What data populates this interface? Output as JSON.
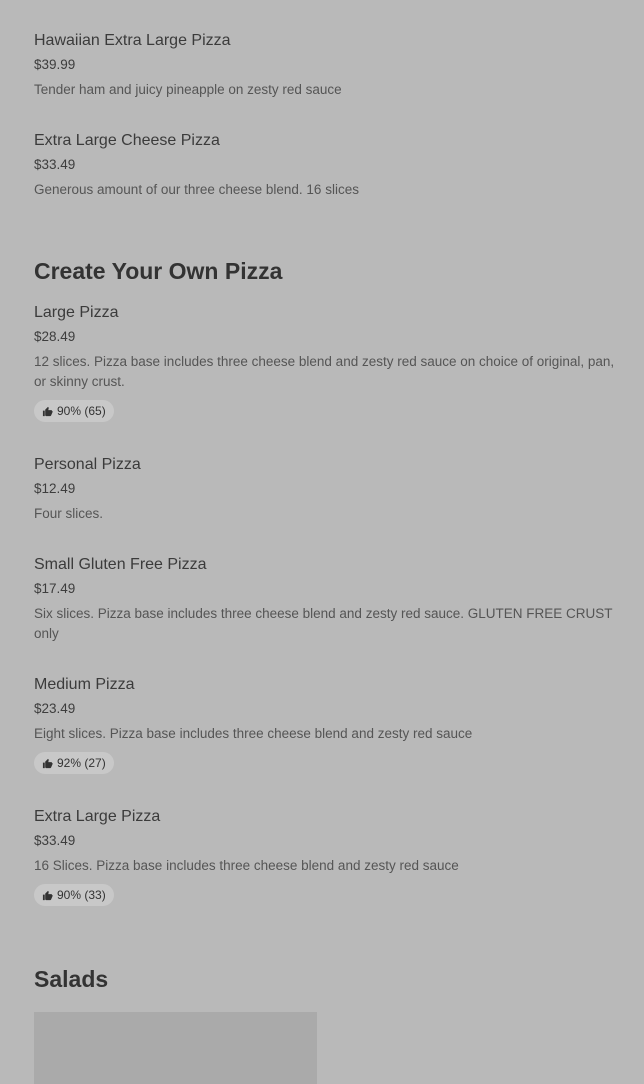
{
  "items_top": [
    {
      "name": "Hawaiian Extra Large Pizza",
      "price": "$39.99",
      "description": "Tender ham and juicy pineapple on zesty red sauce"
    },
    {
      "name": "Extra Large Cheese Pizza",
      "price": "$33.49",
      "description": "Generous amount of our three cheese blend. 16 slices"
    }
  ],
  "section_create": {
    "title": "Create Your Own Pizza",
    "items": [
      {
        "name": "Large Pizza",
        "price": "$28.49",
        "description": "12 slices. Pizza base includes three cheese blend and zesty red sauce on choice of original, pan, or skinny crust.",
        "rating": "90% (65)"
      },
      {
        "name": "Personal Pizza",
        "price": "$12.49",
        "description": "Four slices."
      },
      {
        "name": "Small Gluten Free Pizza",
        "price": "$17.49",
        "description": "Six slices. Pizza base includes three cheese blend and zesty red sauce. GLUTEN FREE CRUST only"
      },
      {
        "name": "Medium Pizza",
        "price": "$23.49",
        "description": "Eight slices. Pizza base includes three cheese blend and zesty red sauce",
        "rating": "92% (27)"
      },
      {
        "name": "Extra Large Pizza",
        "price": "$33.49",
        "description": "16 Slices. Pizza base includes three cheese blend and zesty red sauce",
        "rating": "90% (33)"
      }
    ]
  },
  "section_salads": {
    "title": "Salads"
  },
  "icons": {
    "rating": "thumbs-up-icon"
  }
}
